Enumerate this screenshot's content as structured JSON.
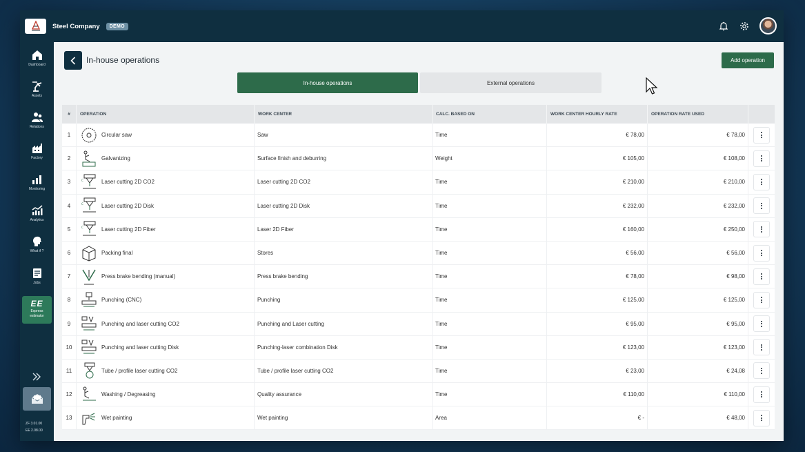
{
  "app": {
    "company": "Steel Company",
    "badge": "DEMO",
    "logo_name": "steel-company-logo"
  },
  "topbar": {
    "icons": [
      "bell-icon",
      "gear-icon",
      "avatar"
    ]
  },
  "sidebar": {
    "items": [
      {
        "label": "Dashboard",
        "icon": "home-icon"
      },
      {
        "label": "Assets",
        "icon": "robot-arm-icon"
      },
      {
        "label": "Relations",
        "icon": "people-icon"
      },
      {
        "label": "Factory",
        "icon": "factory-icon"
      },
      {
        "label": "Monitoring",
        "icon": "bar-chart-icon"
      },
      {
        "label": "Analytics",
        "icon": "analytics-icon"
      },
      {
        "label": "What if ?",
        "icon": "head-icon"
      },
      {
        "label": "Jobs",
        "icon": "jobs-icon"
      }
    ],
    "express": {
      "big": "EE",
      "label_line1": "Express",
      "label_line2": "estimator"
    },
    "versions": {
      "zf": "ZF   3.01.00",
      "ee": "EE   2.08.00"
    }
  },
  "page": {
    "title": "In-house operations",
    "add_button": "Add operation",
    "tabs": [
      {
        "label": "In-house operations",
        "active": true
      },
      {
        "label": "External operations",
        "active": false
      }
    ]
  },
  "table": {
    "headers": {
      "num": "#",
      "operation": "OPERATION",
      "work_center": "WORK CENTER",
      "calc": "CALC. BASED ON",
      "hourly_rate": "WORK CENTER HOURLY RATE",
      "rate_used": "OPERATION RATE USED"
    },
    "rows": [
      {
        "num": "1",
        "operation": "Circular saw",
        "work_center": "Saw",
        "calc": "Time",
        "hourly_rate": "€ 78,00",
        "rate_used": "€ 78,00",
        "icon": "circular-saw-icon"
      },
      {
        "num": "2",
        "operation": "Galvanizing",
        "work_center": "Surface finish and deburring",
        "calc": "Weight",
        "hourly_rate": "€ 105,00",
        "rate_used": "€ 108,00",
        "icon": "galvanizing-icon"
      },
      {
        "num": "3",
        "operation": "Laser cutting 2D CO2",
        "work_center": "Laser cutting 2D CO2",
        "calc": "Time",
        "hourly_rate": "€ 210,00",
        "rate_used": "€ 210,00",
        "icon": "laser-cutter-icon"
      },
      {
        "num": "4",
        "operation": "Laser cutting 2D Disk",
        "work_center": "Laser cutting 2D Disk",
        "calc": "Time",
        "hourly_rate": "€ 232,00",
        "rate_used": "€ 232,00",
        "icon": "laser-cutter-icon"
      },
      {
        "num": "5",
        "operation": "Laser cutting 2D Fiber",
        "work_center": "Laser 2D Fiber",
        "calc": "Time",
        "hourly_rate": "€ 160,00",
        "rate_used": "€ 250,00",
        "icon": "laser-cutter-icon"
      },
      {
        "num": "6",
        "operation": "Packing final",
        "work_center": "Stores",
        "calc": "Time",
        "hourly_rate": "€ 56,00",
        "rate_used": "€ 56,00",
        "icon": "package-icon"
      },
      {
        "num": "7",
        "operation": "Press brake bending (manual)",
        "work_center": "Press brake bending",
        "calc": "Time",
        "hourly_rate": "€ 78,00",
        "rate_used": "€ 98,00",
        "icon": "press-brake-icon"
      },
      {
        "num": "8",
        "operation": "Punching (CNC)",
        "work_center": "Punching",
        "calc": "Time",
        "hourly_rate": "€ 125,00",
        "rate_used": "€ 125,00",
        "icon": "punching-icon"
      },
      {
        "num": "9",
        "operation": "Punching and laser cutting CO2",
        "work_center": "Punching and Laser cutting",
        "calc": "Time",
        "hourly_rate": "€ 95,00",
        "rate_used": "€ 95,00",
        "icon": "punch-laser-icon"
      },
      {
        "num": "10",
        "operation": "Punching and laser cutting Disk",
        "work_center": "Punching-laser combination Disk",
        "calc": "Time",
        "hourly_rate": "€ 123,00",
        "rate_used": "€ 123,00",
        "icon": "punch-laser-icon"
      },
      {
        "num": "11",
        "operation": "Tube / profile laser cutting CO2",
        "work_center": "Tube / profile laser cutting CO2",
        "calc": "Time",
        "hourly_rate": "€ 23,00",
        "rate_used": "€ 24,08",
        "icon": "tube-laser-icon"
      },
      {
        "num": "12",
        "operation": "Washing / Degreasing",
        "work_center": "Quality assurance",
        "calc": "Time",
        "hourly_rate": "€ 110,00",
        "rate_used": "€ 110,00",
        "icon": "washing-icon"
      },
      {
        "num": "13",
        "operation": "Wet painting",
        "work_center": "Wet painting",
        "calc": "Area",
        "hourly_rate": "€ -",
        "rate_used": "€ 48,00",
        "icon": "spray-paint-icon"
      }
    ]
  }
}
